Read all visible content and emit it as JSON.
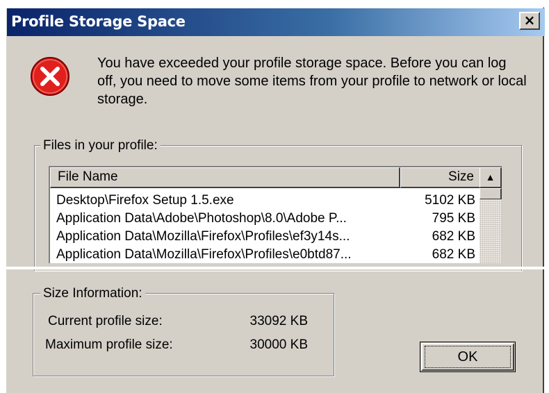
{
  "dialog": {
    "title": "Profile Storage Space",
    "close_glyph": "×",
    "icon": "error-icon",
    "message": "You have exceeded your profile storage space.  Before you can log off, you need to move some items from your profile to network or local storage."
  },
  "files_group": {
    "legend": "Files in your profile:",
    "columns": {
      "name": "File Name",
      "size": "Size"
    },
    "rows": [
      {
        "name": "Desktop\\Firefox Setup 1.5.exe",
        "size": "5102 KB"
      },
      {
        "name": "Application Data\\Adobe\\Photoshop\\8.0\\Adobe P...",
        "size": "795 KB"
      },
      {
        "name": "Application Data\\Mozilla\\Firefox\\Profiles\\ef3y14s...",
        "size": "682 KB"
      },
      {
        "name": "Application Data\\Mozilla\\Firefox\\Profiles\\e0btd87...",
        "size": "682 KB"
      }
    ],
    "scroll_up_glyph": "▲"
  },
  "size_group": {
    "legend": "Size Information:",
    "current_label": "Current profile size:",
    "current_value": "33092 KB",
    "max_label": "Maximum profile size:",
    "max_value": "30000 KB"
  },
  "buttons": {
    "ok": "OK"
  },
  "colors": {
    "dialog_face": "#d4d0c8",
    "title_gradient_start": "#0a246a",
    "title_gradient_end": "#a6caf0",
    "error_red": "#e0201e"
  }
}
